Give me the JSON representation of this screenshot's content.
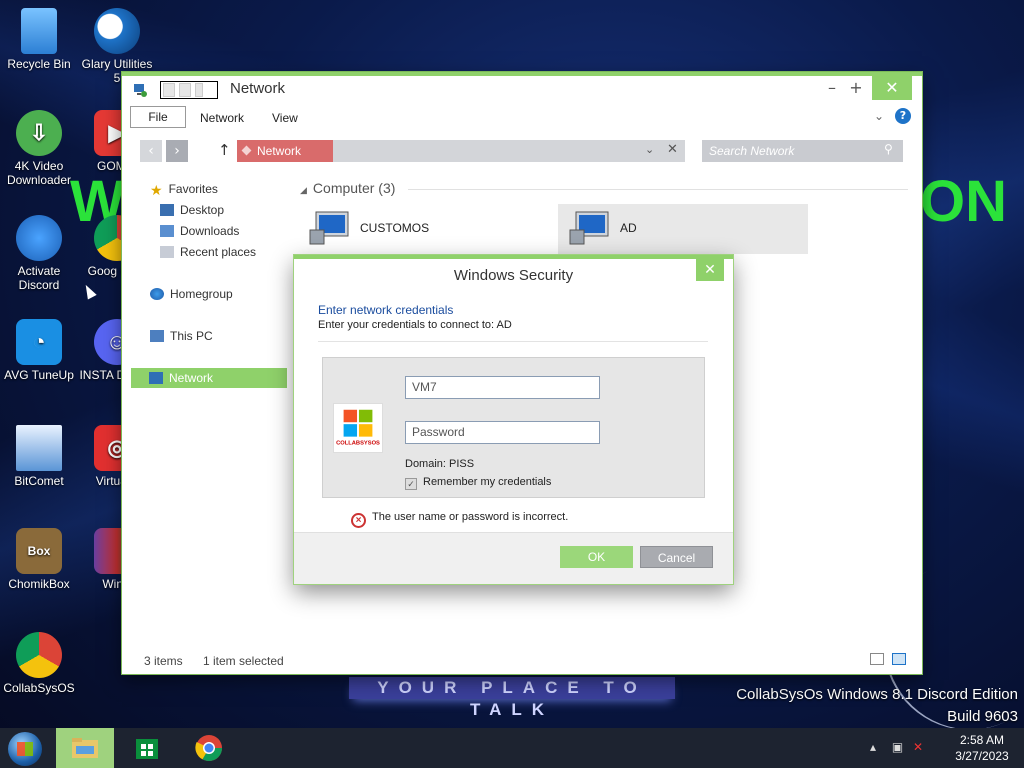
{
  "desktop": {
    "icons": [
      {
        "label": "Recycle Bin",
        "icon": "recycle-bin-icon"
      },
      {
        "label": "Glary Utilities 5",
        "icon": "glary-utilities-icon"
      },
      {
        "label": "4K Video Downloader",
        "icon": "4k-video-downloader-icon"
      },
      {
        "label": "GOM P",
        "icon": "gom-player-icon"
      },
      {
        "label": "Activate Discord",
        "icon": "activate-discord-icon"
      },
      {
        "label": "Goog Chro",
        "icon": "google-chrome-icon"
      },
      {
        "label": "AVG TuneUp",
        "icon": "avg-tuneup-icon"
      },
      {
        "label": "INSTA DISCO",
        "icon": "discord-icon"
      },
      {
        "label": "BitComet",
        "icon": "bitcomet-icon"
      },
      {
        "label": "VirtualD",
        "icon": "virtualdj-icon"
      },
      {
        "label": "ChomikBox",
        "icon": "chomikbox-icon"
      },
      {
        "label": "WinR",
        "icon": "winrar-icon"
      },
      {
        "label": "CollabSysOS",
        "icon": "chrome-collabsysos-icon"
      }
    ],
    "wallpaper_text_left": "W",
    "wallpaper_text_right": "ON",
    "banner": "YOUR PLACE TO TALK",
    "edition_line1": "CollabSysOs Windows 8.1 Discord Edition",
    "edition_line2": "Build 9603"
  },
  "explorer": {
    "title": "Network",
    "ribbon": {
      "file": "File",
      "network": "Network",
      "view": "View",
      "help": "?"
    },
    "address": {
      "crumb": "Network"
    },
    "search": {
      "placeholder": "Search Network"
    },
    "sidebar": {
      "favorites": "Favorites",
      "desktop": "Desktop",
      "downloads": "Downloads",
      "recent": "Recent places",
      "homegroup": "Homegroup",
      "thispc": "This PC",
      "network": "Network"
    },
    "group_header": "Computer (3)",
    "computers": [
      {
        "label": "CUSTOMOS"
      },
      {
        "label": "AD"
      }
    ],
    "status": {
      "count": "3 items",
      "selected": "1 item selected"
    }
  },
  "dialog": {
    "title": "Windows Security",
    "heading": "Enter network credentials",
    "sub": "Enter your credentials to connect to: AD",
    "username": "VM7",
    "password_placeholder": "Password",
    "domain": "Domain: PISS",
    "remember": "Remember my credentials",
    "error": "The user name or password is incorrect.",
    "ok": "OK",
    "cancel": "Cancel",
    "logo_text": "COLLABSYSOS"
  },
  "taskbar": {
    "time": "2:58 AM",
    "date": "3/27/2023"
  },
  "colors": {
    "accent": "#8fd16a",
    "link": "#1a4c9e",
    "error": "#cc3333"
  }
}
